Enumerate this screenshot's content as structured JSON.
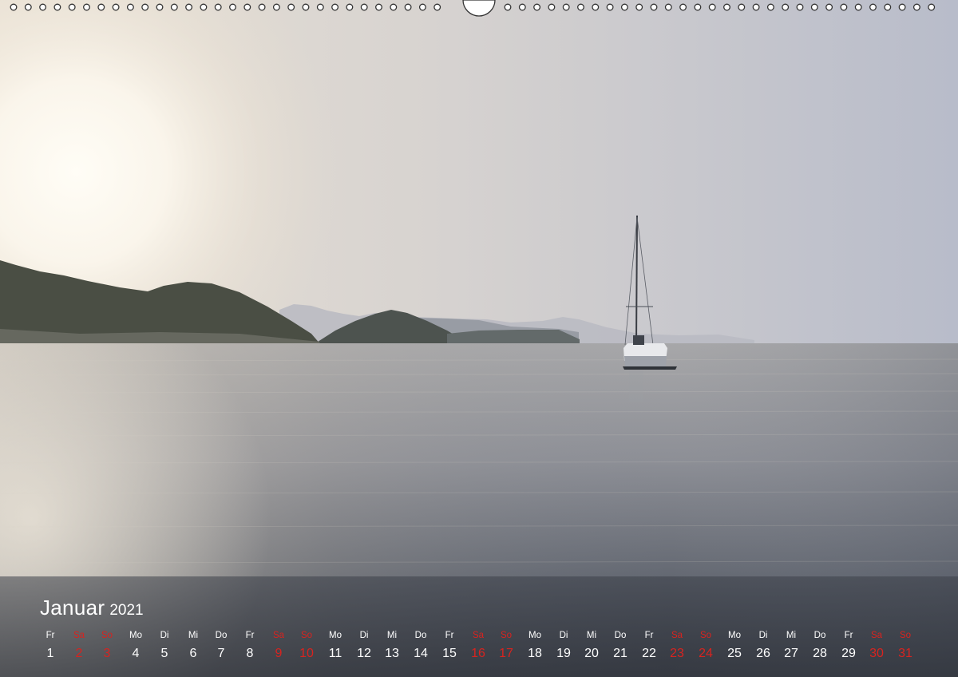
{
  "calendar": {
    "month": "Januar",
    "year": "2021",
    "weekend_color": "#d8231f",
    "days": [
      {
        "name": "Fr",
        "num": "1",
        "weekend": false
      },
      {
        "name": "Sa",
        "num": "2",
        "weekend": true
      },
      {
        "name": "So",
        "num": "3",
        "weekend": true
      },
      {
        "name": "Mo",
        "num": "4",
        "weekend": false
      },
      {
        "name": "Di",
        "num": "5",
        "weekend": false
      },
      {
        "name": "Mi",
        "num": "6",
        "weekend": false
      },
      {
        "name": "Do",
        "num": "7",
        "weekend": false
      },
      {
        "name": "Fr",
        "num": "8",
        "weekend": false
      },
      {
        "name": "Sa",
        "num": "9",
        "weekend": true
      },
      {
        "name": "So",
        "num": "10",
        "weekend": true
      },
      {
        "name": "Mo",
        "num": "11",
        "weekend": false
      },
      {
        "name": "Di",
        "num": "12",
        "weekend": false
      },
      {
        "name": "Mi",
        "num": "13",
        "weekend": false
      },
      {
        "name": "Do",
        "num": "14",
        "weekend": false
      },
      {
        "name": "Fr",
        "num": "15",
        "weekend": false
      },
      {
        "name": "Sa",
        "num": "16",
        "weekend": true
      },
      {
        "name": "So",
        "num": "17",
        "weekend": true
      },
      {
        "name": "Mo",
        "num": "18",
        "weekend": false
      },
      {
        "name": "Di",
        "num": "19",
        "weekend": false
      },
      {
        "name": "Mi",
        "num": "20",
        "weekend": false
      },
      {
        "name": "Do",
        "num": "21",
        "weekend": false
      },
      {
        "name": "Fr",
        "num": "22",
        "weekend": false
      },
      {
        "name": "Sa",
        "num": "23",
        "weekend": true
      },
      {
        "name": "So",
        "num": "24",
        "weekend": true
      },
      {
        "name": "Mo",
        "num": "25",
        "weekend": false
      },
      {
        "name": "Di",
        "num": "26",
        "weekend": false
      },
      {
        "name": "Mi",
        "num": "27",
        "weekend": false
      },
      {
        "name": "Do",
        "num": "28",
        "weekend": false
      },
      {
        "name": "Fr",
        "num": "29",
        "weekend": false
      },
      {
        "name": "Sa",
        "num": "30",
        "weekend": true
      },
      {
        "name": "So",
        "num": "31",
        "weekend": true
      }
    ]
  }
}
